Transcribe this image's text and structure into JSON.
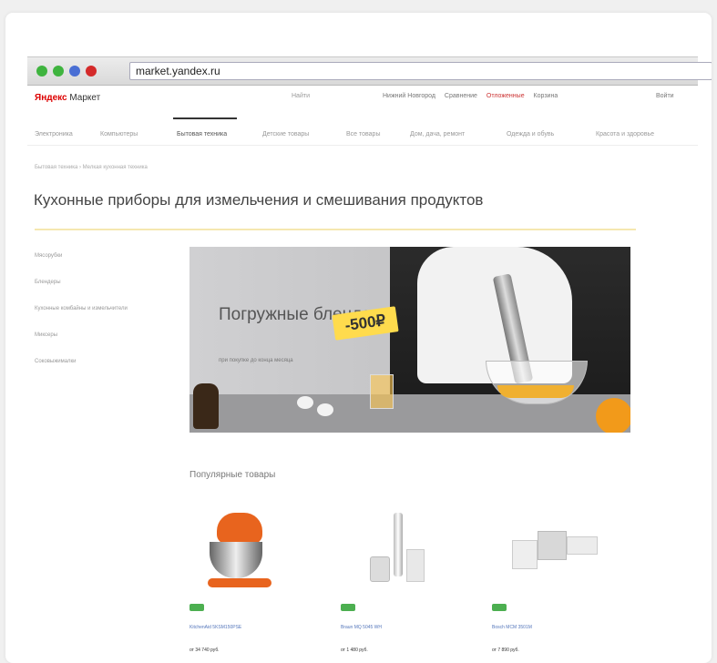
{
  "browser": {
    "url": "market.yandex.ru",
    "dot_colors": [
      "#3fb43f",
      "#3fb43f",
      "#4a6fd4",
      "#d42a2a"
    ]
  },
  "header": {
    "logo_brand": "Яндекс",
    "logo_product": "Маркет",
    "search_label": "Найти",
    "links": [
      "Нижний Новгород",
      "Сравнение",
      "Отложенные",
      "Корзина"
    ],
    "login": "Войти"
  },
  "nav": {
    "tabs": [
      "Электроника",
      "Компьютеры",
      "Бытовая техника",
      "Детские товары",
      "Все товары",
      "Дом, дача, ремонт",
      "Одежда и обувь",
      "Красота и здоровье"
    ],
    "active_index": 2
  },
  "breadcrumb": "Бытовая техника › Мелкая кухонная техника",
  "page_title": "Кухонные приборы для измельчения и смешивания продуктов",
  "sidebar": {
    "items": [
      "Мясорубки",
      "Блендеры",
      "Кухонные комбайны и измельчители",
      "Миксеры",
      "Соковыжималки"
    ]
  },
  "banner": {
    "title": "Погружные блендеры",
    "subtitle": "при покупке до конца месяца",
    "promo": "-500₽"
  },
  "popular": {
    "title": "Популярные товары",
    "products": [
      {
        "name": "KitchenAid 5KSM150PSE",
        "price": "от 34 740 руб.",
        "badge_color": "#4caf50"
      },
      {
        "name": "Braun MQ 5045 WH",
        "price": "от 1 480 руб.",
        "badge_color": "#4caf50"
      },
      {
        "name": "Bosch MCM 3501M",
        "price": "от 7 890 руб.",
        "badge_color": "#4caf50"
      }
    ]
  }
}
